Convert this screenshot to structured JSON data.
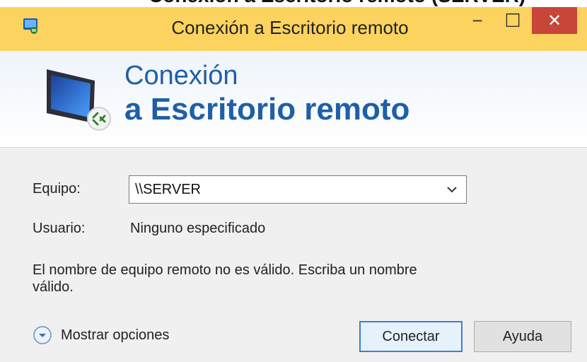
{
  "top_strip": {
    "text": "Conexión a Escritorio remoto (SERVER)"
  },
  "window": {
    "title": "Conexión a Escritorio remoto",
    "controls": {
      "minimize": "−",
      "maximize": "☐",
      "close": "✕"
    }
  },
  "header": {
    "line1": "Conexión",
    "line2": "a Escritorio remoto"
  },
  "form": {
    "equipo_label": "Equipo:",
    "equipo_value": "\\\\SERVER",
    "usuario_label": "Usuario:",
    "usuario_value": "Ninguno especificado",
    "message": "El nombre de equipo remoto no es válido. Escriba un nombre válido."
  },
  "footer": {
    "options_label": "Mostrar opciones",
    "connect_label": "Conectar",
    "help_label": "Ayuda"
  },
  "colors": {
    "titlebar": "#fbd35e",
    "close": "#c8453a",
    "header_text": "#1f5fa6",
    "window_bg": "#f0f0f0"
  },
  "icons": {
    "titlebar": "remote-desktop-icon",
    "header": "monitor-connection-icon",
    "options": "chevron-circle-icon",
    "combo": "chevron-down-icon"
  }
}
